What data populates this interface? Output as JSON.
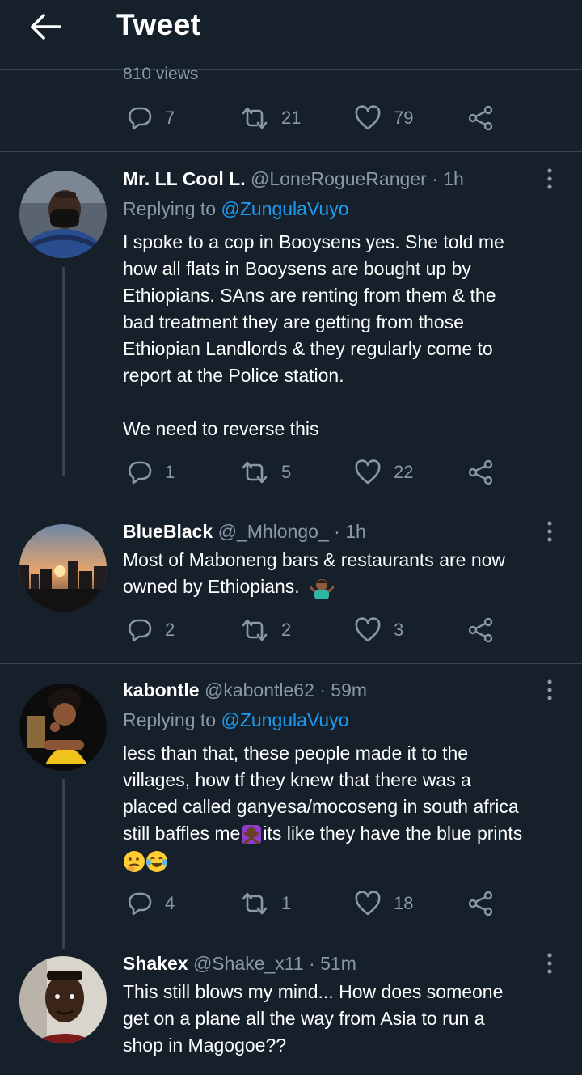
{
  "header": {
    "title": "Tweet"
  },
  "main_tweet": {
    "views": "810 views",
    "actions": {
      "replies": "7",
      "retweets": "21",
      "likes": "79"
    }
  },
  "replies": [
    {
      "name": "Mr. LL Cool L.",
      "handle": "@LoneRogueRanger",
      "time": "· 1h",
      "replying_prefix": "Replying to ",
      "replying_to": "@ZungulaVuyo",
      "lines": [
        "I spoke to a cop in Booysens yes. She told me",
        "how all flats in Booysens are bought up by",
        "Ethiopians. SAns are renting from them & the",
        "bad treatment they are getting from those",
        "Ethiopian Landlords & they regularly come to",
        "report at the Police station.",
        "",
        "We need to reverse this"
      ],
      "actions": {
        "replies": "1",
        "retweets": "5",
        "likes": "22"
      }
    },
    {
      "name": "BlueBlack",
      "handle": "@_Mhlongo_",
      "time": "· 1h",
      "lines": [
        "Most of Maboneng bars & restaurants are now",
        "owned by Ethiopians."
      ],
      "emoji_after_last_line": "man-shrugging-emoji",
      "actions": {
        "replies": "2",
        "retweets": "2",
        "likes": "3"
      }
    },
    {
      "name": "kabontle",
      "handle": "@kabontle62",
      "time": "· 59m",
      "replying_prefix": "Replying to ",
      "replying_to": "@ZungulaVuyo",
      "lines": [
        "less than that, these people made it to the",
        "villages, how tf they knew that there was a",
        "placed called ganyesa/mocoseng in south africa",
        "still baffles me",
        "its like they have the blue prints"
      ],
      "inline_emoji": "woman-gesturing-no-emoji",
      "trailing_emojis": [
        "thinking-face-emoji",
        "tears-of-joy-emoji"
      ],
      "actions": {
        "replies": "4",
        "retweets": "1",
        "likes": "18"
      }
    },
    {
      "name": "Shakex",
      "handle": "@Shake_x11",
      "time": "· 51m",
      "lines": [
        "This still blows my mind... How does someone",
        "get on a plane all the way from Asia to run a",
        "shop in Magogoe??"
      ]
    }
  ],
  "colors": {
    "background": "#15202b",
    "secondary_text": "#8b98a5",
    "link": "#1d9bf0",
    "divider": "#38444d"
  },
  "icons": [
    "back-arrow-icon",
    "reply-icon",
    "retweet-icon",
    "like-icon",
    "share-icon",
    "more-options-icon"
  ]
}
